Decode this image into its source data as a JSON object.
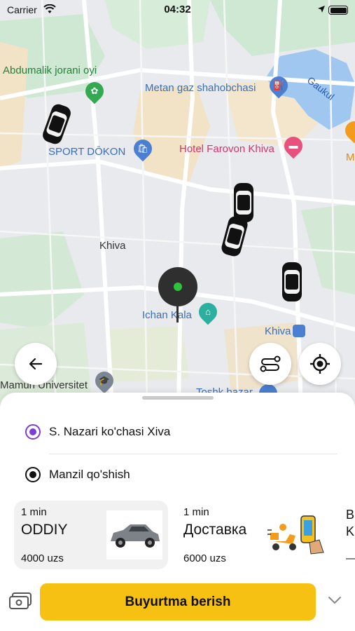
{
  "status_bar": {
    "carrier": "Carrier",
    "time": "04:32"
  },
  "map": {
    "labels": {
      "park": "Abdumalik jorani oyi",
      "gas_station": "Metan gaz shahobchasi",
      "lake": "Gaukul",
      "shop": "SPORT DŌKON",
      "hotel": "Hotel Farovon Khiva",
      "city": "Khiva",
      "landmark": "Ichan Kala",
      "station": "Khiva",
      "university": "Mamun Universitet",
      "bazaar": "Toshk bazar",
      "edge": "M"
    },
    "colors": {
      "green": "#23803a",
      "blue": "#3a6fb8",
      "pink": "#d1366b",
      "water": "#9fc7f0"
    }
  },
  "buttons": {
    "back_icon": "arrow-left-icon",
    "route_icon": "route-icon",
    "locate_icon": "crosshair-icon"
  },
  "addresses": {
    "from": "S. Nazari ko'chasi  Xiva",
    "to": "Manzil qo'shish"
  },
  "tariffs": [
    {
      "time": "1 min",
      "name": "ODDIY",
      "price": "4000 uzs",
      "selected": true
    },
    {
      "time": "1 min",
      "name": "Доставка",
      "price": "6000 uzs",
      "selected": false
    },
    {
      "time": "",
      "name": "B",
      "subname": "K",
      "price": "—",
      "selected": false
    }
  ],
  "order": {
    "label": "Buyurtma berish"
  },
  "accent_color": "#f6c113"
}
